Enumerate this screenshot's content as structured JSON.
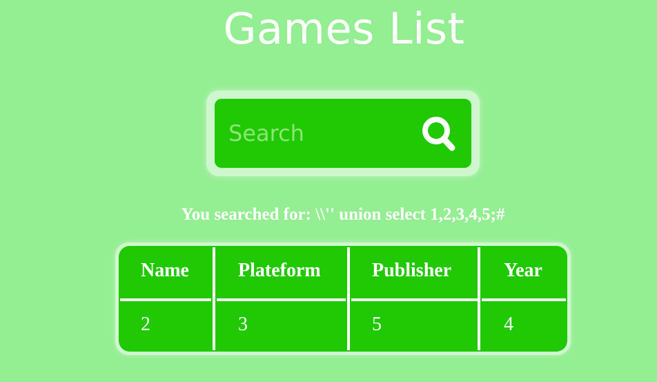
{
  "page": {
    "title": "Games List"
  },
  "search": {
    "placeholder": "Search",
    "value": "",
    "icon": "search-icon"
  },
  "result": {
    "searched_text": "You searched for: \\\\'' union select 1,2,3,4,5;#"
  },
  "table": {
    "headers": [
      "Name",
      "Plateform",
      "Publisher",
      "Year"
    ],
    "rows": [
      [
        "2",
        "3",
        "5",
        "4"
      ]
    ]
  },
  "colors": {
    "background": "#94ee92",
    "accent": "#21c804",
    "text": "#ffffff"
  }
}
